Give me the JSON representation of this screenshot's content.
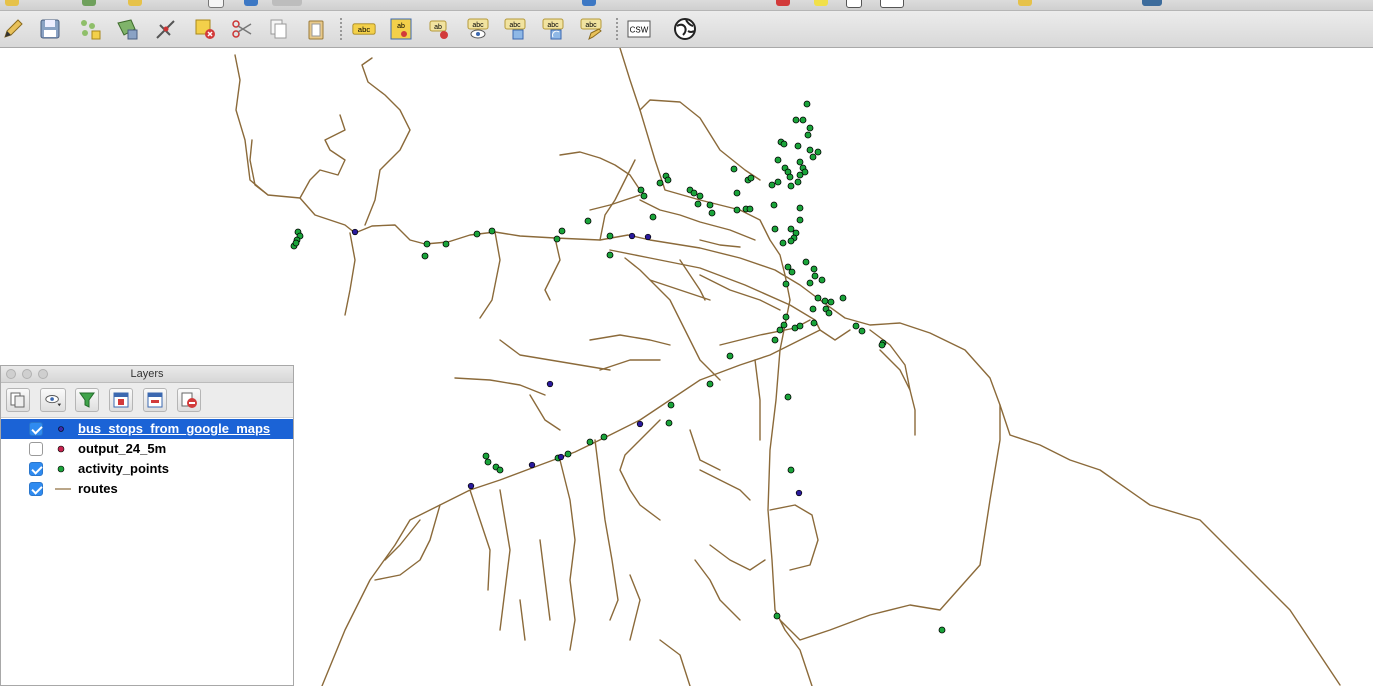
{
  "panel": {
    "title": "Layers",
    "layers": [
      {
        "name": "bus_stops_from_google_maps",
        "checked": true,
        "selected": true,
        "symbol": "point",
        "color": "#2a1a9c"
      },
      {
        "name": "output_24_5m",
        "checked": false,
        "selected": false,
        "symbol": "point",
        "color": "#c8234f"
      },
      {
        "name": "activity_points",
        "checked": true,
        "selected": false,
        "symbol": "point",
        "color": "#1aa43a"
      },
      {
        "name": "routes",
        "checked": true,
        "selected": false,
        "symbol": "line",
        "color": "#8b6a3a"
      }
    ]
  },
  "toolbar": {
    "csw_label": "CSW",
    "abc_label": "abc",
    "ab_label": "ab"
  },
  "map": {
    "route_color": "#8b6a3a",
    "activity_color": "#1aa43a",
    "bus_stop_color": "#2a1a9c"
  }
}
